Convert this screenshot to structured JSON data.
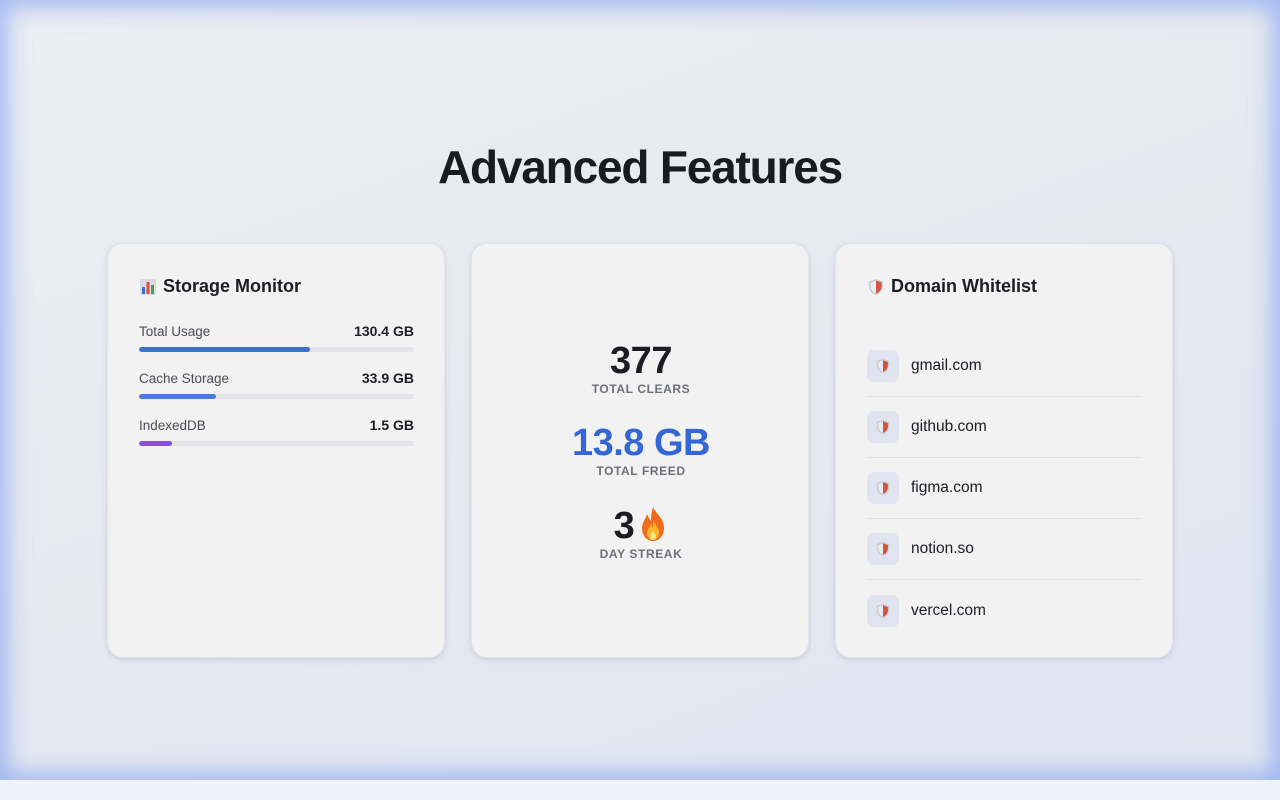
{
  "page": {
    "title": "Advanced Features"
  },
  "storage_monitor": {
    "title": "Storage Monitor",
    "icon": "bar-chart-icon",
    "metrics": [
      {
        "label": "Total Usage",
        "value": "130.4 GB",
        "fill_percent": 62,
        "color": "#3d6fdb"
      },
      {
        "label": "Cache Storage",
        "value": "33.9 GB",
        "fill_percent": 28,
        "color": "#4a7ae0"
      },
      {
        "label": "IndexedDB",
        "value": "1.5 GB",
        "fill_percent": 12,
        "color": "#8a4fe0"
      }
    ]
  },
  "stats": {
    "clears": {
      "value": "377",
      "label": "TOTAL CLEARS"
    },
    "freed": {
      "value": "13.8 GB",
      "label": "TOTAL FREED",
      "color": "#3466d6"
    },
    "streak": {
      "value": "3",
      "label": "DAY STREAK",
      "icon": "fire-icon"
    }
  },
  "whitelist": {
    "title": "Domain Whitelist",
    "icon": "shield-icon",
    "domains": [
      "gmail.com",
      "github.com",
      "figma.com",
      "notion.so",
      "vercel.com"
    ]
  }
}
